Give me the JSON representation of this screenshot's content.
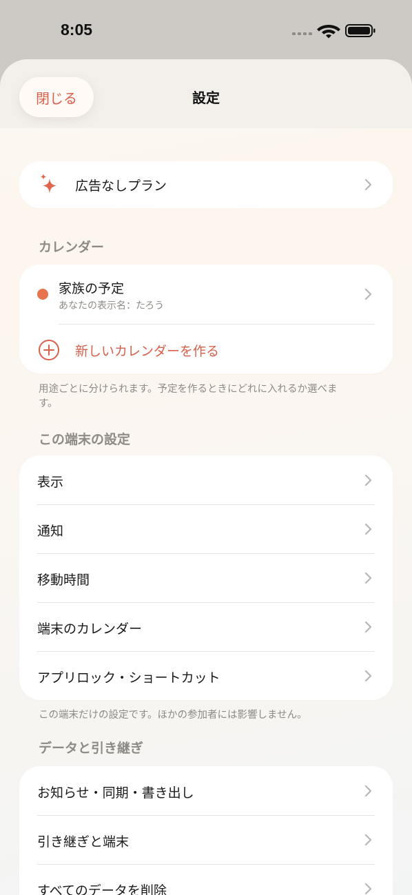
{
  "status_bar": {
    "time": "8:05"
  },
  "nav": {
    "close_label": "閉じる",
    "title": "設定"
  },
  "premium": {
    "label": "広告なしプラン",
    "icon": "sparkle-icon",
    "accent": "#e0644e"
  },
  "calendar_section": {
    "header": "カレンダー",
    "calendar": {
      "name": "家族の予定",
      "subtitle": "あなたの表示名：たろう",
      "dot_color": "#e8734f"
    },
    "new_calendar_label": "新しいカレンダーを作る",
    "footnote": "用途ごとに分けられます。予定を作るときにどれに入れるか選べます。"
  },
  "device_section": {
    "header": "この端末の設定",
    "items": [
      {
        "label": "表示"
      },
      {
        "label": "通知"
      },
      {
        "label": "移動時間"
      },
      {
        "label": "端末のカレンダー"
      },
      {
        "label": "アプリロック・ショートカット"
      }
    ],
    "footnote": "この端末だけの設定です。ほかの参加者には影響しません。"
  },
  "data_section": {
    "header": "データと引き継ぎ",
    "items": [
      {
        "label": "お知らせ・同期・書き出し"
      },
      {
        "label": "引き継ぎと端末"
      },
      {
        "label": "すべてのデータを削除"
      }
    ]
  }
}
